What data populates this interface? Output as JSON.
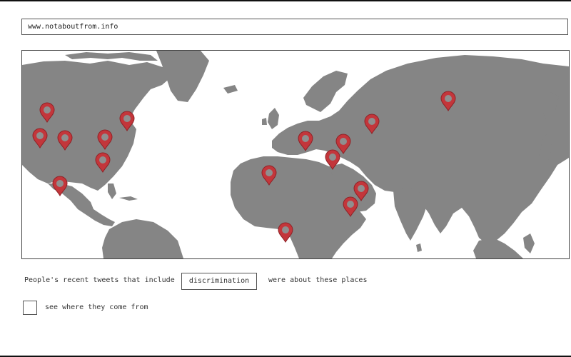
{
  "url_bar": {
    "text": "www.notaboutfrom.info"
  },
  "query": {
    "prefix": "People's recent tweets that include",
    "keyword": "discrimination",
    "suffix": "were about these places"
  },
  "toggle": {
    "label": "see where they come from",
    "checked": false
  },
  "colors": {
    "land": "#858585",
    "ocean": "#ffffff",
    "pin": "#c3363b",
    "pin_dark": "#8e2226",
    "pin_inner": "#8f8f8f"
  },
  "map": {
    "icon": "map-marker-icon",
    "pins": [
      {
        "place": "western-canada"
      },
      {
        "place": "pacific-northwest-us"
      },
      {
        "place": "northern-great-plains-us"
      },
      {
        "place": "great-lakes-us"
      },
      {
        "place": "quebec-canada"
      },
      {
        "place": "eastern-us"
      },
      {
        "place": "southwestern-us"
      },
      {
        "place": "central-europe"
      },
      {
        "place": "turkey"
      },
      {
        "place": "black-sea-region"
      },
      {
        "place": "western-russia"
      },
      {
        "place": "central-russia"
      },
      {
        "place": "north-africa-algeria"
      },
      {
        "place": "persian-gulf"
      },
      {
        "place": "arabian-peninsula"
      },
      {
        "place": "nigeria"
      }
    ]
  }
}
